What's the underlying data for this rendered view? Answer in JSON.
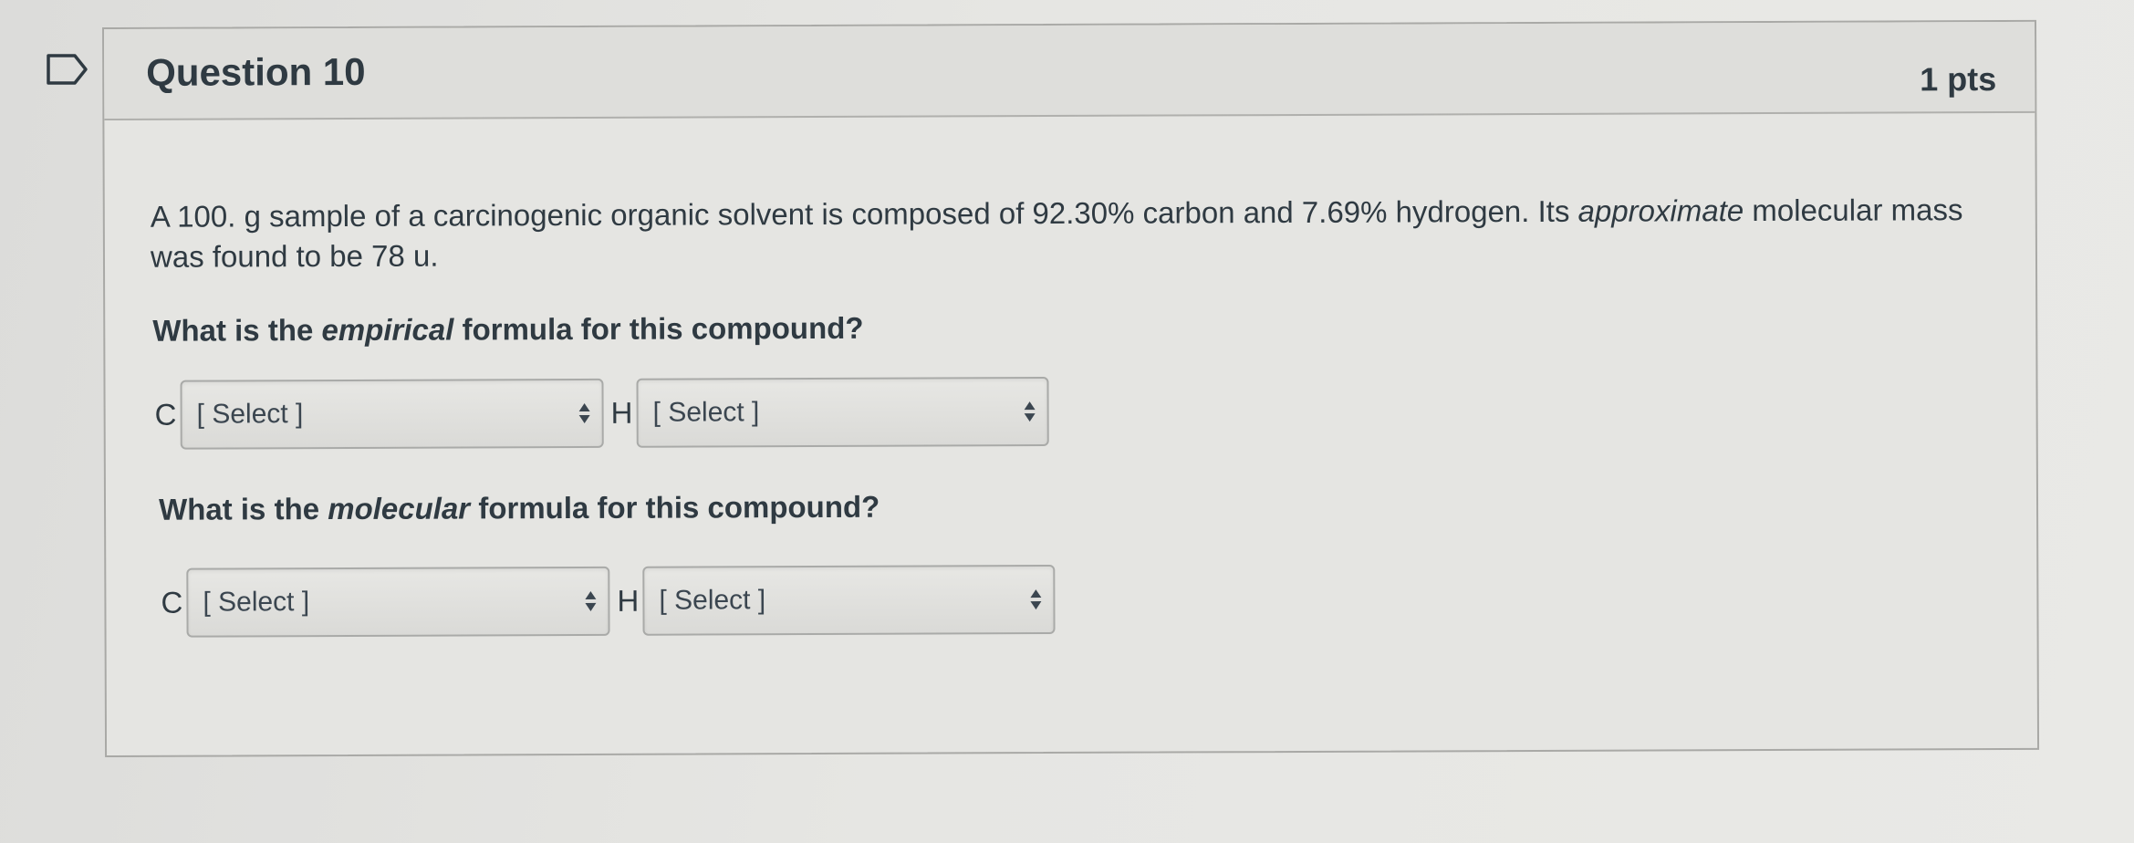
{
  "question": {
    "title": "Question 10",
    "points": "1 pts",
    "text_before": "A 100. g sample of a carcinogenic organic solvent is composed of 92.30% carbon and 7.69% hydrogen. Its ",
    "text_emphasis": "approximate",
    "text_after": " molecular mass was found to be 78 u."
  },
  "empirical": {
    "before": "What is the ",
    "emphasis": "empirical",
    "after": " formula for this compound?",
    "c_symbol": "C",
    "c_select": "[ Select ]",
    "h_symbol": "H",
    "h_select": "[ Select ]"
  },
  "molecular": {
    "before": "What is the ",
    "emphasis": "molecular",
    "after": " formula for this compound?",
    "c_symbol": "C",
    "c_select": "[ Select ]",
    "h_symbol": "H",
    "h_select": "[ Select ]"
  },
  "icons": {
    "flag": "bookmark-flag-icon",
    "select_arrow": "sort-arrows-icon"
  },
  "colors": {
    "flag_stroke": "#2f3a42",
    "text": "#2f3a42",
    "border": "#a9a9a6"
  }
}
